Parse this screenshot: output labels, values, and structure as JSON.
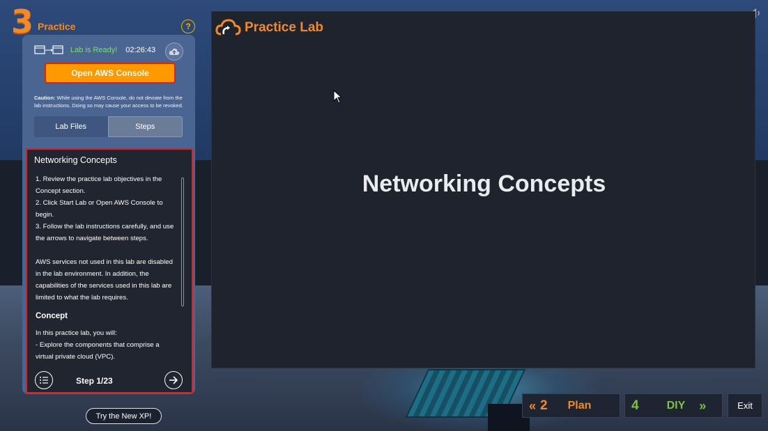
{
  "header": {
    "step_number": "3",
    "step_title": "Practice",
    "help_icon": "question-circle-icon"
  },
  "lab": {
    "status_text": "Lab is Ready!",
    "timer": "02:26:43",
    "open_console_label": "Open AWS Console",
    "caution_label": "Caution:",
    "caution_text": " While using the AWS Console, do not deviate from the lab instructions. Doing so may cause your access to be revoked.",
    "tabs": [
      {
        "label": "Lab Files"
      },
      {
        "label": "Steps"
      }
    ]
  },
  "steps": {
    "heading": "Networking Concepts",
    "items": [
      "1. Review the practice lab objectives in the Concept section.",
      "2. Click Start Lab or Open AWS Console to begin.",
      "3. Follow the lab instructions carefully, and use the arrows to navigate between steps."
    ],
    "note": "AWS services not used in this lab are disabled in the lab environment. In addition, the capabilities of the services used in this lab are limited to what the lab requires.",
    "concept_heading": "Concept",
    "concept_intro": "In this practice lab, you will:",
    "concept_item": " - Explore the components that comprise a virtual private cloud (VPC).",
    "counter": "Step 1/23"
  },
  "try_new_xp_label": "Try the New XP!",
  "main": {
    "logo_text": "Practice Lab",
    "title": "Networking Concepts"
  },
  "nav": {
    "prev_number": "2",
    "prev_label": "Plan",
    "next_number": "4",
    "next_label": "DIY",
    "exit_label": "Exit"
  },
  "colors": {
    "accent_orange": "#f08a2c",
    "aws_button": "#ff9900",
    "ready_green": "#7dd97a",
    "diy_green": "#7dc242",
    "highlight_red": "#e21e1e"
  }
}
